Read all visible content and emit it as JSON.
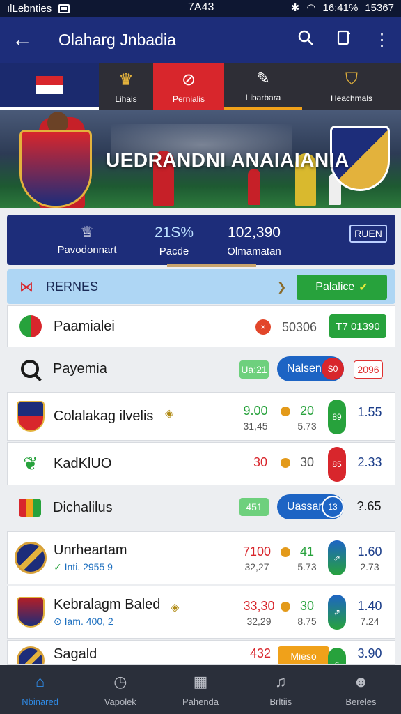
{
  "status_bar": {
    "carrier": "ılLebnties",
    "time": "7A43",
    "battery": "16:41%",
    "clock_right": "15367"
  },
  "app_bar": {
    "title": "Olaharg Jnbadia"
  },
  "category_tabs": [
    {
      "label": "",
      "icon": "flag-icon"
    },
    {
      "label": "Lihais",
      "icon": "crown-icon"
    },
    {
      "label": "Pernialis",
      "icon": "no-whistle-icon"
    },
    {
      "label": "Libarbara",
      "icon": "boot-icon"
    },
    {
      "label": "Heachmals",
      "icon": "shield-number-icon"
    }
  ],
  "hero": {
    "title": "UEDRANDNI ANAIAIANIA"
  },
  "stats": {
    "label_left": "Pavodonnart",
    "value_mid": "21S%",
    "label_mid": "Pacde",
    "value_right": "102,390",
    "label_right": "Olmamatan",
    "button": "RUEN"
  },
  "section_header": {
    "label": "RERNES",
    "action_label": "Palalice"
  },
  "rows": [
    {
      "name": "Paamialei",
      "time": "50306",
      "badge": "T7 01390"
    },
    {
      "name": "Payemia",
      "pill": "Ua:21",
      "seg_label": "Nalsen",
      "seg_dot": "S0",
      "red_badge": "2096"
    },
    {
      "name": "Colalakag ilvelis",
      "o1": "9.00",
      "o1b": "31,45",
      "o2": "20",
      "o2b": "5.73",
      "cap": "89",
      "o3": "1.55"
    },
    {
      "name": "KadKlUO",
      "o1": "30",
      "o2": "30",
      "cap": "85",
      "o3": "2.33"
    },
    {
      "name": "Dichalilus",
      "pill": "451",
      "seg_label": "Uassar",
      "seg_dot": "13",
      "o3": "?.65"
    },
    {
      "name": "Unrheartam",
      "sub": "Inti. 2955 9",
      "o1": "7100",
      "o1b": "32,27",
      "o2": "41",
      "o2b": "5.73",
      "o3": "1.60",
      "o3b": "2.73"
    },
    {
      "name": "Kebralagm Baled",
      "sub": "Iam. 400, 2",
      "o1": "33,30",
      "o1b": "32,29",
      "o2": "30",
      "o2b": "8.75",
      "o3": "1.40",
      "o3b": "7.24"
    },
    {
      "name": "Sagald",
      "o1": "432",
      "pill": "Mieso",
      "o3": "3.90"
    }
  ],
  "bottom_nav": [
    {
      "label": "Nbinared",
      "icon": "home-icon",
      "active": true
    },
    {
      "label": "Vapolek",
      "icon": "clock-icon",
      "active": false
    },
    {
      "label": "Pahenda",
      "icon": "ticket-icon",
      "active": false
    },
    {
      "label": "Brltiis",
      "icon": "bell-icon",
      "active": false
    },
    {
      "label": "Bereles",
      "icon": "user-icon",
      "active": false
    }
  ],
  "colors": {
    "primary": "#1d2d7a",
    "accent_red": "#d8262c",
    "accent_green": "#27a23c",
    "nav_bg": "#2a2f3a"
  }
}
